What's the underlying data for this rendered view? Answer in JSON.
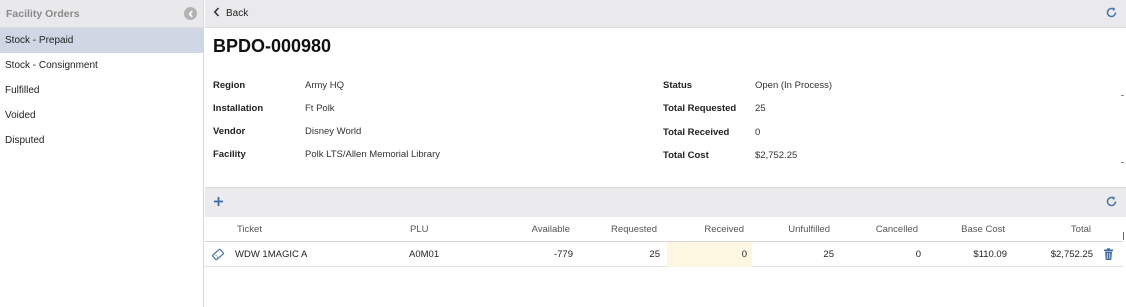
{
  "sidebar": {
    "title": "Facility Orders",
    "items": [
      {
        "label": "Stock - Prepaid",
        "active": true
      },
      {
        "label": "Stock - Consignment",
        "active": false
      },
      {
        "label": "Fulfilled",
        "active": false
      },
      {
        "label": "Voided",
        "active": false
      },
      {
        "label": "Disputed",
        "active": false
      }
    ]
  },
  "topbar": {
    "back_label": "Back"
  },
  "order": {
    "number": "BPDO-000980",
    "left_fields": [
      {
        "label": "Region",
        "value": "Army HQ"
      },
      {
        "label": "Installation",
        "value": "Ft Polk"
      },
      {
        "label": "Vendor",
        "value": "Disney World"
      },
      {
        "label": "Facility",
        "value": "Polk LTS/Allen Memorial Library"
      }
    ],
    "right_fields": [
      {
        "label": "Status",
        "value": "Open (In Process)"
      },
      {
        "label": "Total Requested",
        "value": "25"
      },
      {
        "label": "Total Received",
        "value": "0"
      },
      {
        "label": "Total Cost",
        "value": "$2,752.25"
      }
    ]
  },
  "grid": {
    "add_icon": "plus-icon",
    "columns": [
      "Ticket",
      "PLU",
      "Available",
      "Requested",
      "Received",
      "Unfulfilled",
      "Cancelled",
      "Base Cost",
      "Total"
    ],
    "rows": [
      {
        "ticket": "WDW 1MAGIC A",
        "plu": "A0M01",
        "available": "-779",
        "requested": "25",
        "received": "0",
        "unfulfilled": "25",
        "cancelled": "0",
        "base_cost": "$110.09",
        "total": "$2,752.25"
      }
    ]
  },
  "colors": {
    "active_nav": "#cfd6e4",
    "accent": "#3f6aa6",
    "received_highlight": "#fdf6e0"
  }
}
